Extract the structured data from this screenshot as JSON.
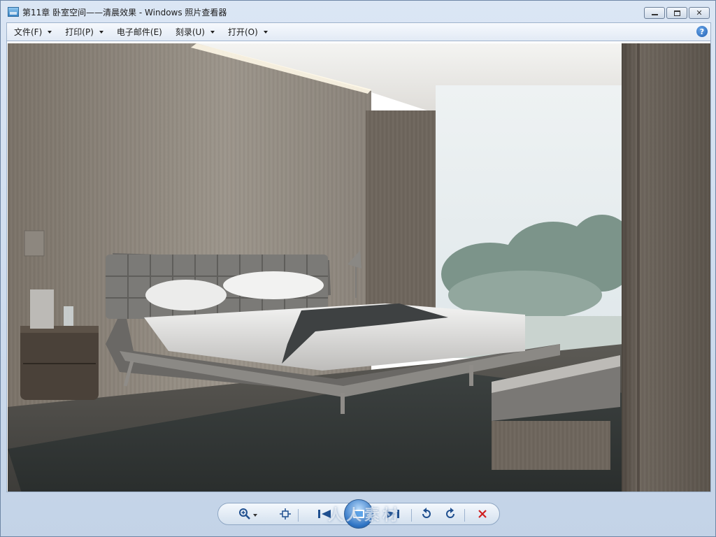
{
  "window": {
    "title": "第11章  卧室空间——清晨效果 - Windows 照片查看器",
    "app_icon": "photo-viewer-icon",
    "controls": {
      "minimize": "▁",
      "maximize": "□",
      "close": "✕"
    }
  },
  "menu": {
    "items": [
      {
        "label": "文件(F)",
        "has_dropdown": true
      },
      {
        "label": "打印(P)",
        "has_dropdown": true
      },
      {
        "label": "电子邮件(E)",
        "has_dropdown": false
      },
      {
        "label": "刻录(U)",
        "has_dropdown": true
      },
      {
        "label": "打开(O)",
        "has_dropdown": true
      }
    ],
    "help": "?"
  },
  "image": {
    "subject": "bedroom-morning-render",
    "alt": "第11章 卧室空间——清晨效果"
  },
  "toolbar": {
    "zoom": "zoom-icon",
    "actual_size": "fit-window-icon",
    "previous": "previous-icon",
    "slideshow": "slideshow-icon",
    "next": "next-icon",
    "rotate_ccw": "rotate-counterclockwise-icon",
    "rotate_cw": "rotate-clockwise-icon",
    "delete": "delete-icon",
    "delete_color": "#d02020",
    "accent_color": "#2f74c4"
  },
  "watermark": {
    "text": "人人素材"
  }
}
